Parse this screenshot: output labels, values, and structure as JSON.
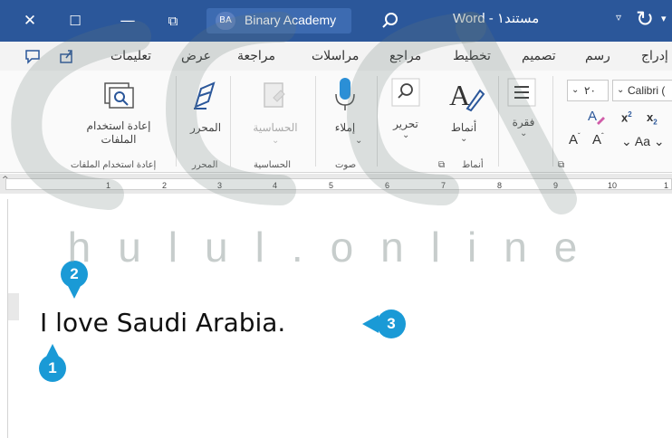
{
  "window": {
    "title": "Word - مستند١",
    "account_name": "Binary Academy",
    "account_initials": "BA",
    "controls": {
      "close": "✕",
      "maximize": "☐",
      "minimize": "—",
      "restore": "⧉"
    },
    "icons": [
      "search-icon",
      "undo-icon",
      "quick-access-dropdown-icon"
    ]
  },
  "tabs": [
    {
      "id": "home",
      "label": "إدراج"
    },
    {
      "id": "draw",
      "label": "رسم"
    },
    {
      "id": "design",
      "label": "تصميم"
    },
    {
      "id": "layout",
      "label": "تخطيط"
    },
    {
      "id": "references",
      "label": "مراجع"
    },
    {
      "id": "mailings",
      "label": "مراسلات"
    },
    {
      "id": "review",
      "label": "مراجعة"
    },
    {
      "id": "view",
      "label": "عرض"
    },
    {
      "id": "help",
      "label": "تعليمات"
    }
  ],
  "ribbon": {
    "reuse_files": {
      "command": "إعادة استخدام الملفات",
      "group": "إعادة استخدام الملفات"
    },
    "editor": {
      "command": "المحرر",
      "group": "المحرر"
    },
    "sensitivity": {
      "command": "الحساسية",
      "group": "الحساسية"
    },
    "dictate": {
      "command": "إملاء",
      "group": "صوت"
    },
    "editing": {
      "command": "تحرير"
    },
    "styles": {
      "command": "أنماط",
      "group": "أنماط"
    },
    "paragraph": {
      "command": "فقرة"
    },
    "font": {
      "size": "٢٠",
      "name": "Calibri (",
      "grow_label": "A",
      "shrink_label": "A",
      "case_label": "Aa"
    }
  },
  "ruler": {
    "numbers": [
      "1",
      "2",
      "3",
      "4",
      "5",
      "6",
      "7",
      "8",
      "9",
      "10",
      "1"
    ]
  },
  "document": {
    "text": "I love Saudi Arabia."
  },
  "callouts": [
    "1",
    "2",
    "3"
  ],
  "watermark": {
    "text": "hulul.online"
  },
  "colors": {
    "titlebar": "#2b579a",
    "callout": "#1a9ad6",
    "ribbon_bg": "#fafafa"
  }
}
